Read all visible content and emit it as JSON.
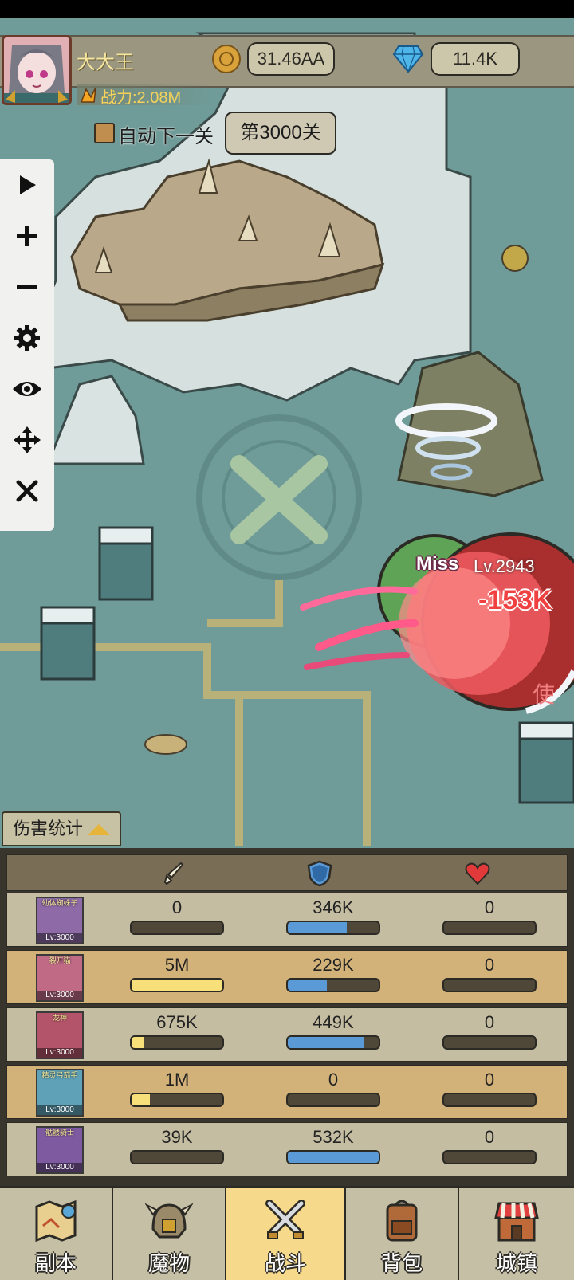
{
  "player": {
    "name": "大大王",
    "power": "战力:2.08M"
  },
  "currency": {
    "gold": "31.46AA",
    "gems": "11.4K"
  },
  "stage": {
    "auto_next_label": "自动下一关",
    "stage_label": "第3000关"
  },
  "toolbar": [
    "play-icon",
    "zoom-in-icon",
    "zoom-out-icon",
    "gear-icon",
    "eye-icon",
    "move-icon",
    "close-icon"
  ],
  "battle": {
    "miss": "Miss",
    "enemy_level": "Lv.2943",
    "damage": "-153K",
    "enemy_name_partial": "使"
  },
  "damage_stats": {
    "tab_label": "伤害统计",
    "columns": [
      "sword-icon",
      "shield-icon",
      "heart-icon"
    ],
    "rows": [
      {
        "name": "幼体蜘蛛子",
        "level": "Lv:3000",
        "attack": "0",
        "defense": "346K",
        "heal": "0",
        "attack_pct": 0,
        "defense_pct": 0.65,
        "heal_pct": 0,
        "color": "#8e6aa6"
      },
      {
        "name": "裂开猫",
        "level": "Lv:3000",
        "attack": "5M",
        "defense": "229K",
        "heal": "0",
        "attack_pct": 1.0,
        "defense_pct": 0.43,
        "heal_pct": 0,
        "color": "#c06a86"
      },
      {
        "name": "龙神",
        "level": "Lv:3000",
        "attack": "675K",
        "defense": "449K",
        "heal": "0",
        "attack_pct": 0.14,
        "defense_pct": 0.84,
        "heal_pct": 0,
        "color": "#b3546a"
      },
      {
        "name": "精灵弓箭手",
        "level": "Lv:3000",
        "attack": "1M",
        "defense": "0",
        "heal": "0",
        "attack_pct": 0.2,
        "defense_pct": 0,
        "heal_pct": 0,
        "color": "#5fa2b8"
      },
      {
        "name": "骷髅骑士",
        "level": "Lv:3000",
        "attack": "39K",
        "defense": "532K",
        "heal": "0",
        "attack_pct": 0,
        "defense_pct": 1.0,
        "heal_pct": 0,
        "color": "#7e5aa0"
      }
    ]
  },
  "nav": [
    {
      "label": "副本",
      "icon": "map-icon",
      "active": false
    },
    {
      "label": "魔物",
      "icon": "monster-helmet-icon",
      "active": false
    },
    {
      "label": "战斗",
      "icon": "crossed-swords-icon",
      "active": true
    },
    {
      "label": "背包",
      "icon": "backpack-icon",
      "active": false
    },
    {
      "label": "城镇",
      "icon": "town-shop-icon",
      "active": false
    }
  ],
  "colors": {
    "map": "#6f9b98",
    "gold_text": "#f5d35a",
    "active_tab": "#f6d98a",
    "defense_bar": "#5a9ad6",
    "attack_bar": "#f7df7a"
  }
}
